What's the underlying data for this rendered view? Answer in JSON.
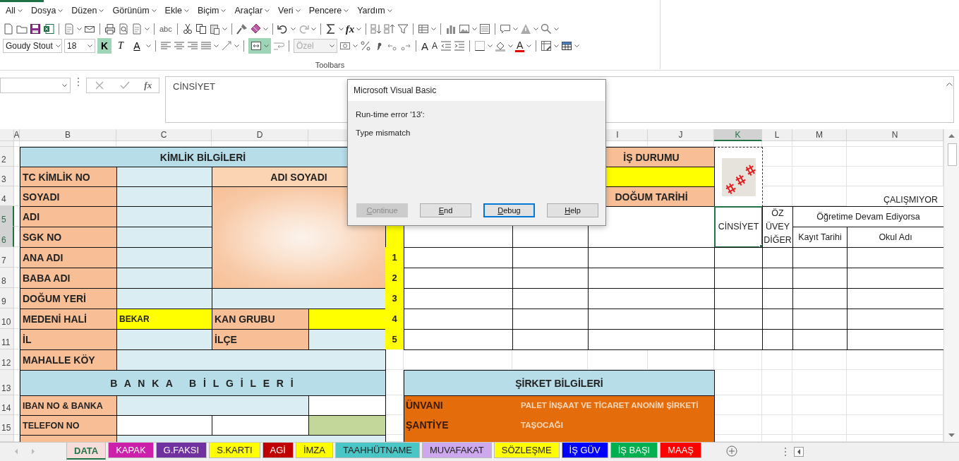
{
  "menu": [
    {
      "label": "All"
    },
    {
      "label": "Dosya"
    },
    {
      "label": "Düzen"
    },
    {
      "label": "Görünüm"
    },
    {
      "label": "Ekle"
    },
    {
      "label": "Biçim"
    },
    {
      "label": "Araçlar"
    },
    {
      "label": "Veri"
    },
    {
      "label": "Pencere"
    },
    {
      "label": "Yardım"
    }
  ],
  "toolbar": {
    "spelling_label": "abc",
    "function_label": "fx",
    "font": "Goudy Stout",
    "size": "18",
    "format_buttons": [
      {
        "label": "K",
        "on": true
      },
      {
        "label": "T",
        "on": false
      },
      {
        "label": "A",
        "on": false
      }
    ],
    "merge_on": true,
    "number_format": {
      "value": "Özel",
      "disabled": true
    },
    "font_size_buttons": [
      {
        "label": "A"
      },
      {
        "label": "A"
      }
    ],
    "font_color_label": "A",
    "caption": "Toolbars"
  },
  "formula_bar": {
    "function_label": "fx",
    "value": "CİNSİYET"
  },
  "sheet": {
    "columns": [
      {
        "label": "A",
        "selected": false
      },
      {
        "label": "B",
        "selected": false
      },
      {
        "label": "C",
        "selected": false
      },
      {
        "label": "D",
        "selected": false
      },
      {
        "label": "I",
        "selected": false
      },
      {
        "label": "J",
        "selected": false
      },
      {
        "label": "K",
        "selected": true
      },
      {
        "label": "L",
        "selected": false
      },
      {
        "label": "M",
        "selected": false
      },
      {
        "label": "N",
        "selected": false
      }
    ],
    "rows": [
      {
        "label": "2",
        "selected": false
      },
      {
        "label": "3",
        "selected": false
      },
      {
        "label": "4",
        "selected": false
      },
      {
        "label": "5",
        "selected": true
      },
      {
        "label": "6",
        "selected": true
      },
      {
        "label": "7",
        "selected": false
      },
      {
        "label": "8",
        "selected": false
      },
      {
        "label": "9",
        "selected": false
      },
      {
        "label": "10",
        "selected": false
      },
      {
        "label": "11",
        "selected": false
      },
      {
        "label": "12",
        "selected": false
      },
      {
        "label": "13",
        "selected": false
      },
      {
        "label": "14",
        "selected": false
      },
      {
        "label": "15",
        "selected": false
      }
    ],
    "cells": [
      {
        "text": "KİMLİK BİLGİLERİ",
        "selected": false
      },
      {
        "text": "İŞ DURUMU",
        "selected": false
      },
      {
        "text": "TC KİMLİK NO",
        "selected": false
      },
      {
        "text": "ADI SOYADI",
        "selected": false
      },
      {
        "text": "SOYADI",
        "selected": false
      },
      {
        "text": "DOĞUM TARİHİ",
        "selected": false
      },
      {
        "text": "ÇALIŞMIYOR",
        "selected": false
      },
      {
        "text": "ADI",
        "selected": false
      },
      {
        "text": "CİNSİYET",
        "selected": true
      },
      {
        "text": "ÖZ ÜVEY DİĞER",
        "selected": false
      },
      {
        "text": "Öğretime Devam Ediyorsa",
        "selected": false
      },
      {
        "text": "SGK NO",
        "selected": false
      },
      {
        "text": "Kayıt Tarihi",
        "selected": false
      },
      {
        "text": "Okul Adı",
        "selected": false
      },
      {
        "text": "ANA ADI",
        "selected": false
      },
      {
        "text": "1",
        "selected": false
      },
      {
        "text": "BABA ADI",
        "selected": false
      },
      {
        "text": "2",
        "selected": false
      },
      {
        "text": "DOĞUM YERİ",
        "selected": false
      },
      {
        "text": "3",
        "selected": false
      },
      {
        "text": "MEDENİ HALİ",
        "selected": false
      },
      {
        "text": "BEKAR",
        "selected": false
      },
      {
        "text": "KAN GRUBU",
        "selected": false
      },
      {
        "text": "4",
        "selected": false
      },
      {
        "text": "İL",
        "selected": false
      },
      {
        "text": "İLÇE",
        "selected": false
      },
      {
        "text": "5",
        "selected": false
      },
      {
        "text": "MAHALLE KÖY",
        "selected": false
      },
      {
        "text": "B A N K A   B İ L G İ L E R İ",
        "selected": false
      },
      {
        "text": "ŞİRKET BİLGİLERİ",
        "selected": false
      },
      {
        "text": "IBAN NO & BANKA",
        "selected": false
      },
      {
        "text": "ÜNVANI",
        "selected": false
      },
      {
        "text": "PALET İNŞAAT VE TİCARET ANONİM ŞİRKETİ",
        "selected": false
      },
      {
        "text": "TELEFON NO",
        "selected": false
      },
      {
        "text": "ŞANTİYE",
        "selected": false
      },
      {
        "text": "TAŞOCAĞI",
        "selected": false
      }
    ]
  },
  "dialog": {
    "title": "Microsoft Visual Basic",
    "error": "Run-time error '13':",
    "message": "Type mismatch",
    "buttons": [
      {
        "label": "Continue",
        "disabled": true,
        "focused": false
      },
      {
        "label": "End",
        "disabled": false,
        "focused": false
      },
      {
        "label": "Debug",
        "disabled": false,
        "focused": true
      },
      {
        "label": "Help",
        "disabled": false,
        "focused": false
      }
    ]
  },
  "sheet_tabs": [
    {
      "label": "DATA",
      "selected": true,
      "color": "#f7dcdc"
    },
    {
      "label": "KAPAK",
      "selected": false,
      "color": "#cc1faa"
    },
    {
      "label": "G.FAKSI",
      "selected": false,
      "color": "#7030a0"
    },
    {
      "label": "S.KARTI",
      "selected": false,
      "color": "#ffff00"
    },
    {
      "label": "AGİ",
      "selected": false,
      "color": "#c00000"
    },
    {
      "label": "İMZA",
      "selected": false,
      "color": "#ffff00"
    },
    {
      "label": "TAAHHÜTNAME",
      "selected": false,
      "color": "#4bc6c6"
    },
    {
      "label": "MUVAFAKAT",
      "selected": false,
      "color": "#cda8ee"
    },
    {
      "label": "SÖZLEŞME",
      "selected": false,
      "color": "#ffff00"
    },
    {
      "label": "İŞ GÜV",
      "selected": false,
      "color": "#0000ff"
    },
    {
      "label": "İŞ BAŞI",
      "selected": false,
      "color": "#00b050"
    },
    {
      "label": "MAAŞ",
      "selected": false,
      "color": "#ff0000"
    }
  ]
}
